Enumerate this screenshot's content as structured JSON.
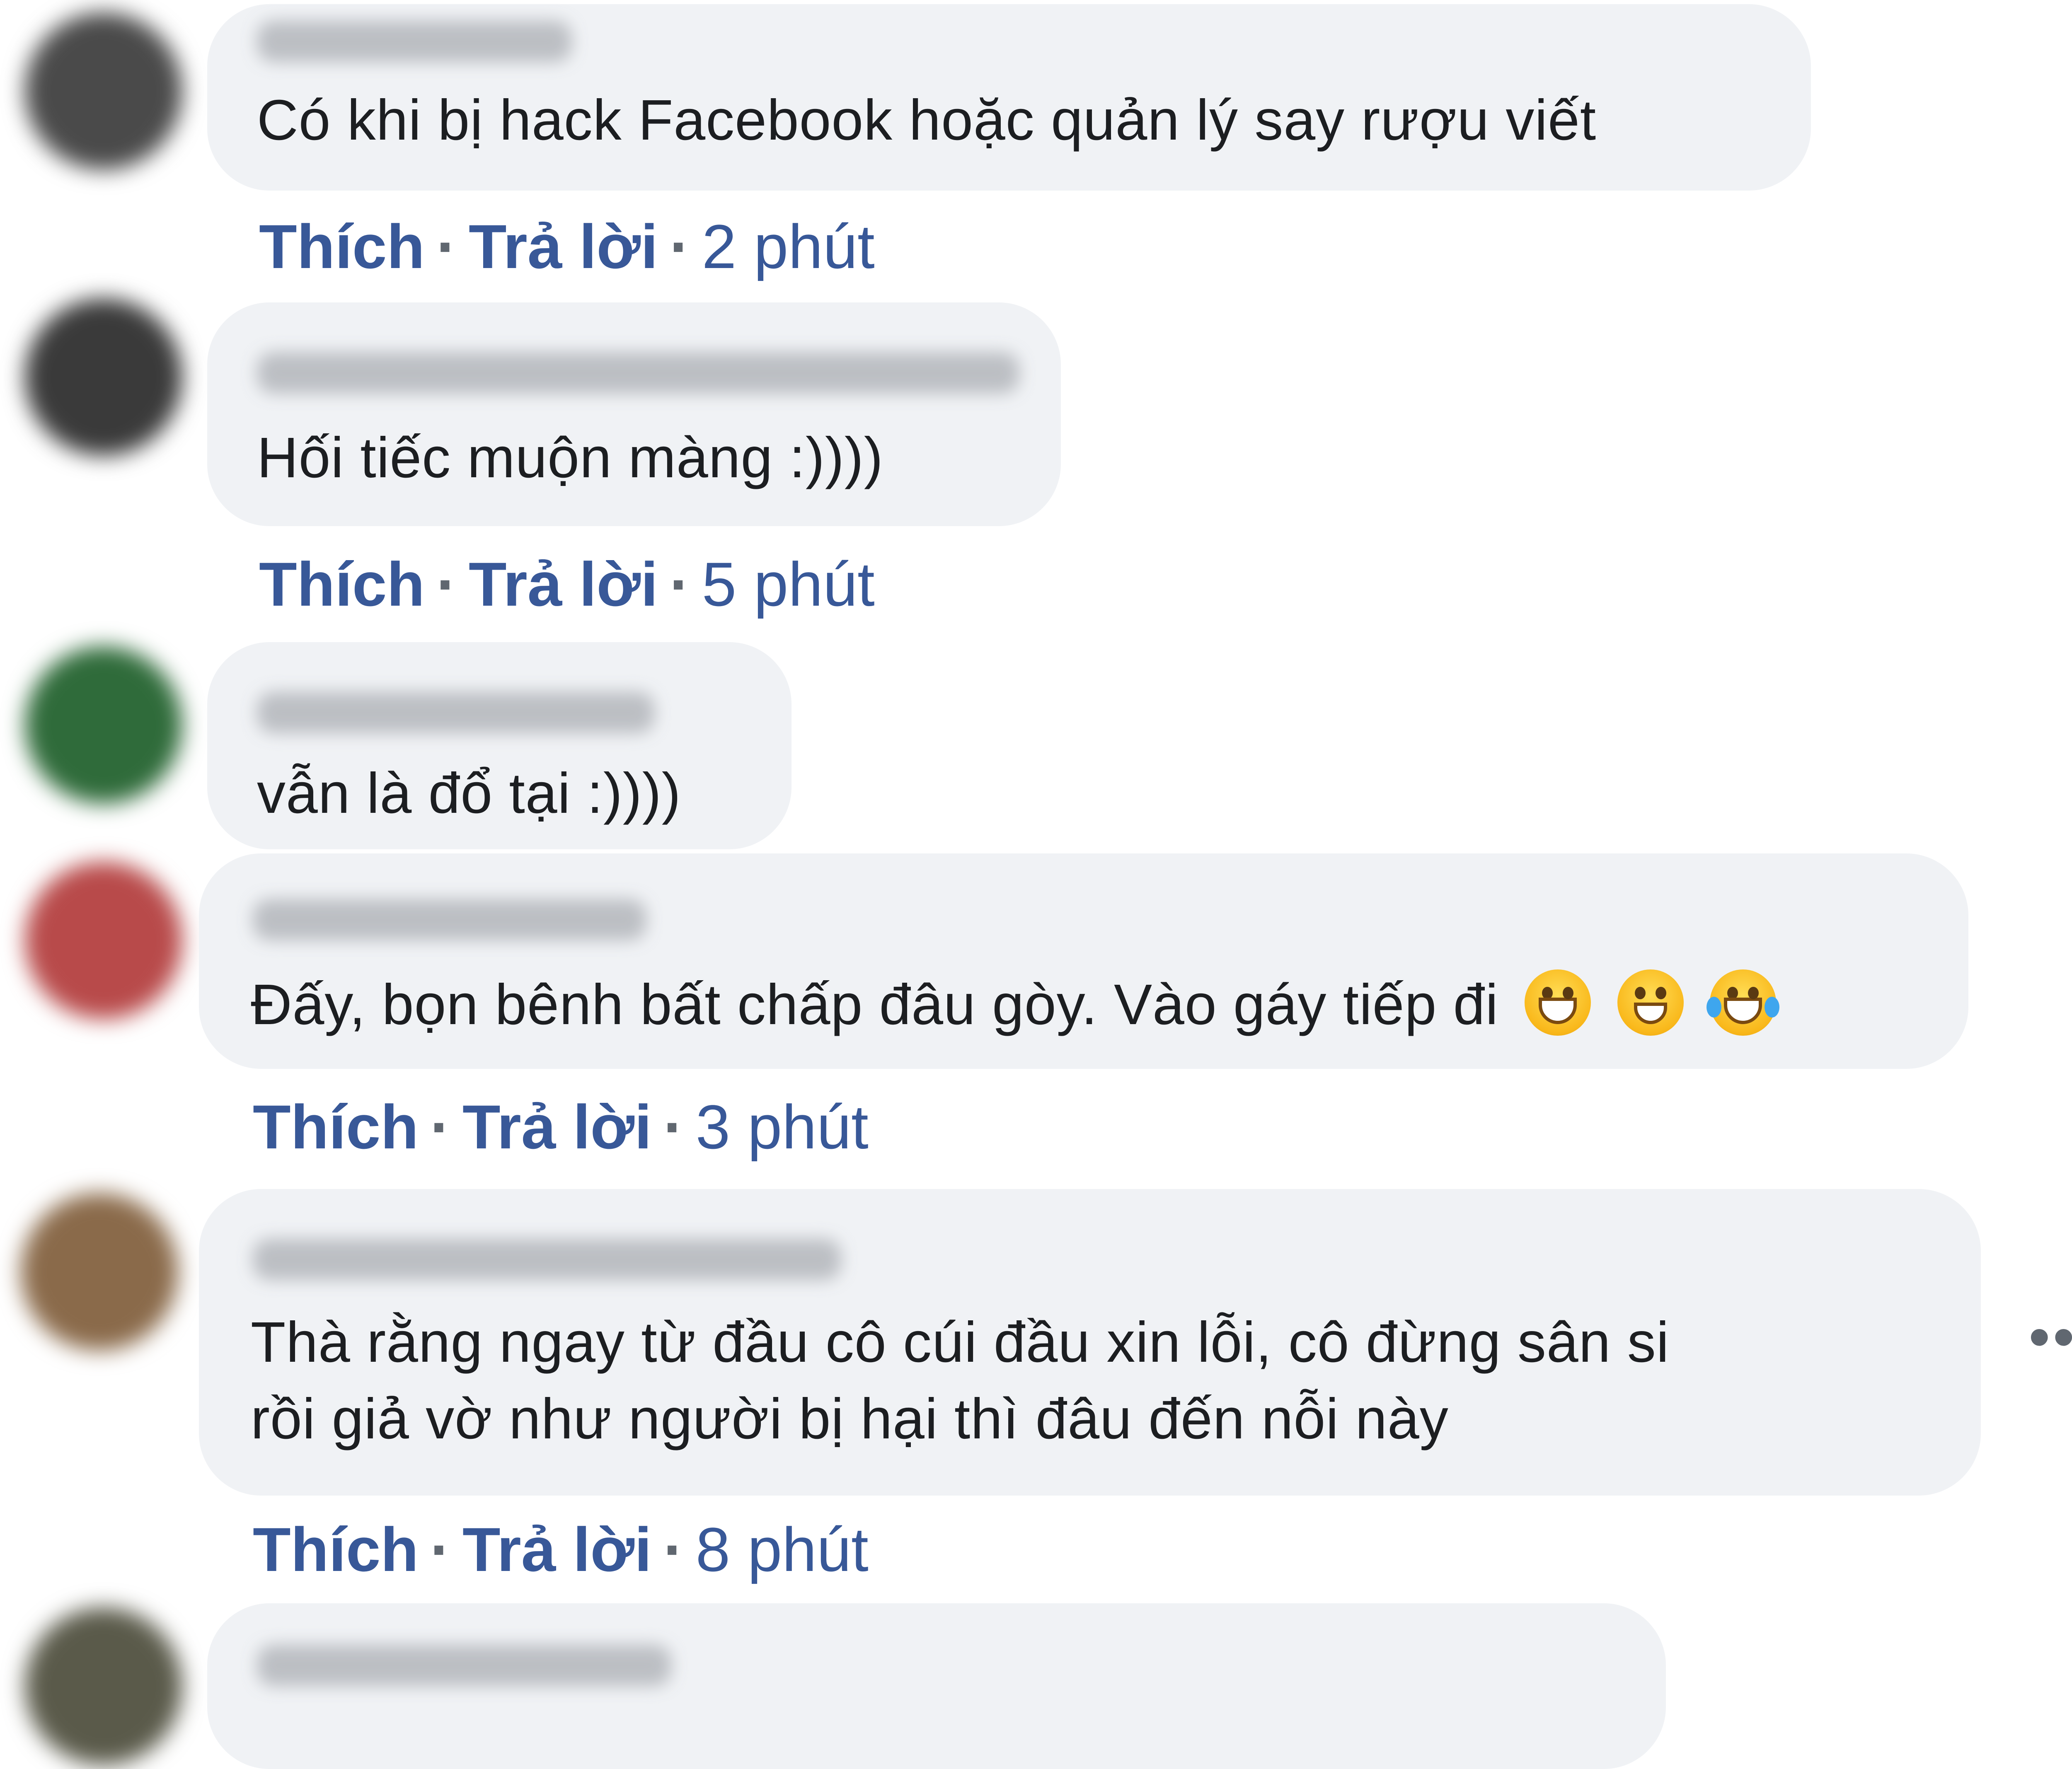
{
  "comments": [
    {
      "text_lines": [
        "Có khi bị hack Facebook hoặc quản lý say rượu viết"
      ],
      "like": "Thích",
      "reply": "Trả lời",
      "separator": "·",
      "time": "2 phút",
      "avatar_color": "#4a4a4a"
    },
    {
      "text_lines": [
        "Hối tiếc muộn màng :))))"
      ],
      "like": "Thích",
      "reply": "Trả lời",
      "separator": "·",
      "time": "5 phút",
      "avatar_color": "#3a3a3a"
    },
    {
      "text_lines": [
        "vẫn là đổ tại :))))"
      ],
      "avatar_color": "#2f6b3a"
    },
    {
      "text_lines": [
        "Đấy, bọn bênh bất chấp đâu gòy. Vào gáy tiếp đi"
      ],
      "emoji_icons": [
        "grinning-face-icon",
        "smiling-face-icon",
        "tears-of-joy-icon"
      ],
      "like": "Thích",
      "reply": "Trả lời",
      "separator": "·",
      "time": "3 phút",
      "avatar_color": "#b84a4a"
    },
    {
      "text_lines": [
        "Thà rằng ngay từ đầu cô cúi đầu xin lỗi, cô đừng sân si",
        "rồi giả vờ như người bị hại thì đâu đến nỗi này"
      ],
      "like": "Thích",
      "reply": "Trả lời",
      "separator": "·",
      "time": "8 phút",
      "more": "•••",
      "avatar_color": "#8a6a4a"
    },
    {
      "text_lines": [],
      "avatar_color": "#5a5a4a"
    }
  ],
  "colors": {
    "bubble": "#f0f2f5",
    "link": "#385898",
    "text": "#1c1e21"
  }
}
